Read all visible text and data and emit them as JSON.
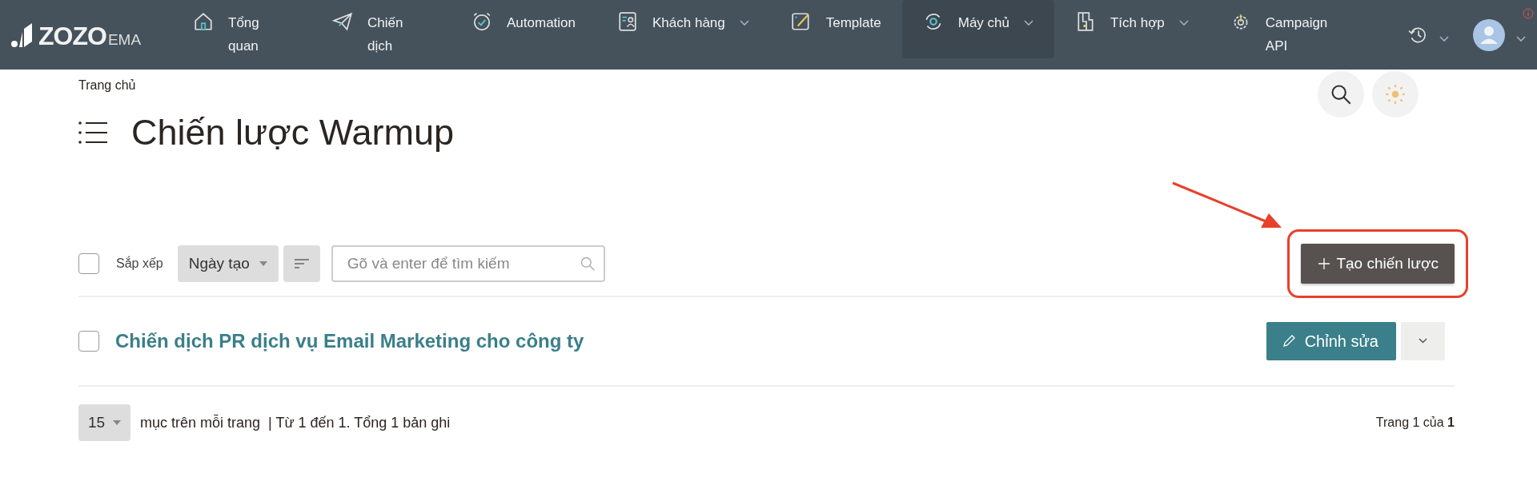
{
  "brand": {
    "name": "ZOZO",
    "suffix": "EMA"
  },
  "nav": [
    {
      "label": "Tổng quan",
      "wrapped": true,
      "selected": false,
      "has_menu": false
    },
    {
      "label": "Chiến dịch",
      "wrapped": true,
      "selected": false,
      "has_menu": false
    },
    {
      "label": "Automation",
      "wrapped": false,
      "selected": false,
      "has_menu": false
    },
    {
      "label": "Khách hàng",
      "wrapped": false,
      "selected": false,
      "has_menu": true
    },
    {
      "label": "Template",
      "wrapped": false,
      "selected": false,
      "has_menu": false
    },
    {
      "label": "Máy chủ",
      "wrapped": false,
      "selected": true,
      "has_menu": true
    },
    {
      "label": "Tích hợp",
      "wrapped": false,
      "selected": false,
      "has_menu": true
    },
    {
      "label": "Campaign API",
      "wrapped": true,
      "selected": false,
      "has_menu": false
    }
  ],
  "header": {
    "breadcrumb": "Trang chủ",
    "title": "Chiến lược Warmup"
  },
  "toolbar": {
    "select_all_checked": false,
    "sort_label": "Sắp xếp",
    "sort_field": "Ngày tạo",
    "search": {
      "placeholder": "Gõ và enter để tìm kiếm"
    },
    "create_button": "Tạo chiến lược"
  },
  "rows": [
    {
      "title": "Chiến dịch PR dịch vụ Email Marketing cho công ty",
      "checked": false,
      "edit_label": "Chỉnh sửa"
    }
  ],
  "footer": {
    "page_size": "15",
    "range_text": "mục trên mỗi trang  | Từ 1 đến 1. Tổng 1 bản ghi",
    "page_info": "Trang 1 của **1**"
  }
}
